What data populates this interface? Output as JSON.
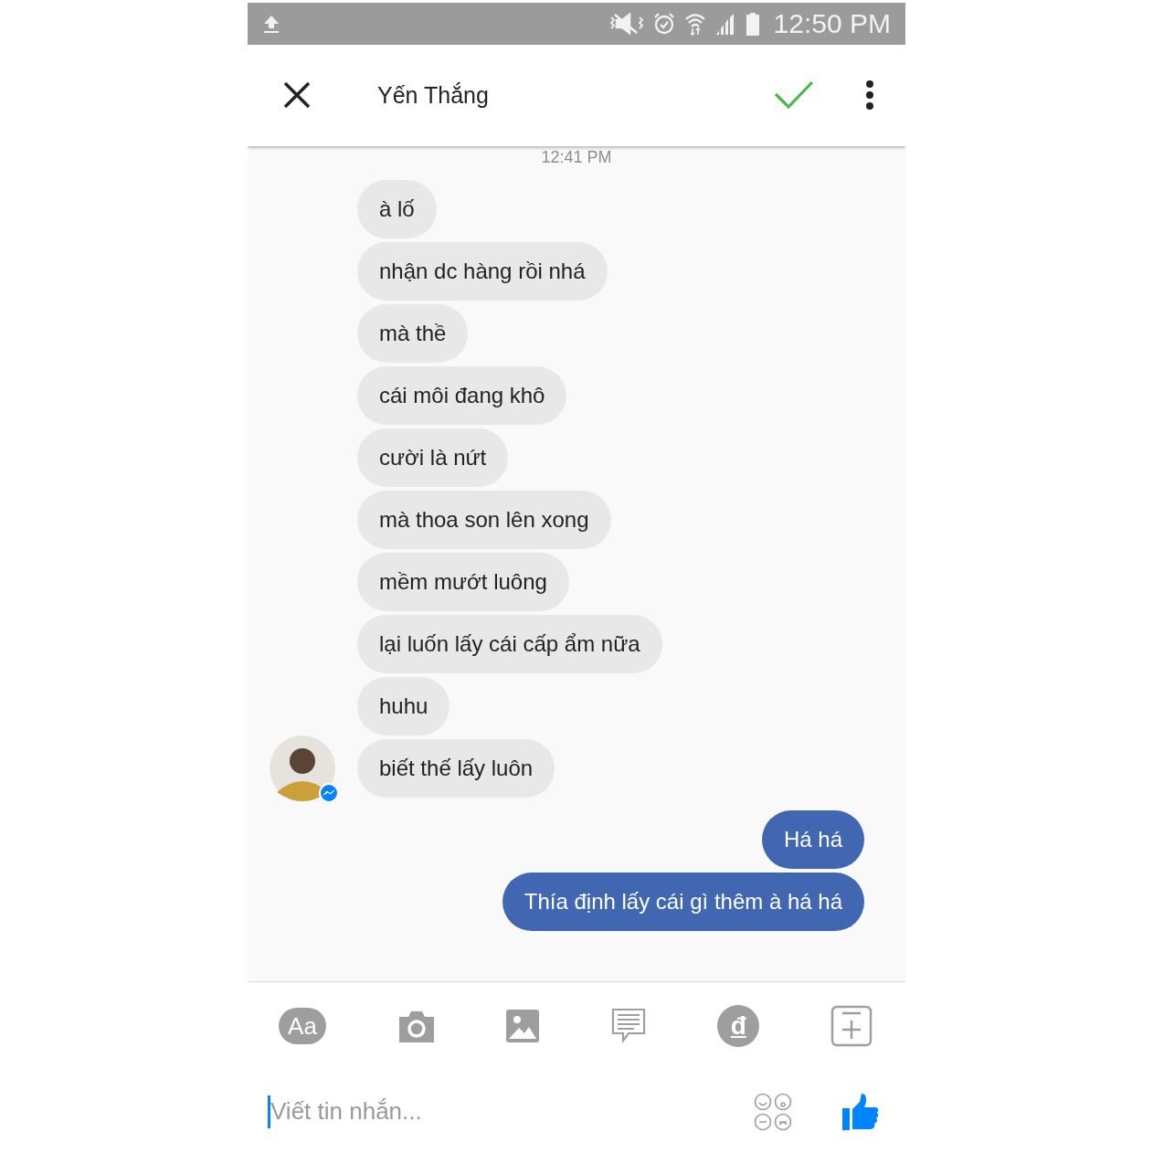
{
  "status_bar": {
    "time": "12:50 PM"
  },
  "header": {
    "title": "Yến Thắng"
  },
  "thread": {
    "timestamp": "12:41 PM",
    "messages": [
      {
        "kind": "incoming",
        "text": "à lố",
        "avatar": false
      },
      {
        "kind": "incoming",
        "text": "nhận dc hàng rồi nhá",
        "avatar": false
      },
      {
        "kind": "incoming",
        "text": "mà thề",
        "avatar": false
      },
      {
        "kind": "incoming",
        "text": "cái môi đang khô",
        "avatar": false
      },
      {
        "kind": "incoming",
        "text": "cười là nứt",
        "avatar": false
      },
      {
        "kind": "incoming",
        "text": "mà thoa son lên xong",
        "avatar": false
      },
      {
        "kind": "incoming",
        "text": "mềm mướt luông",
        "avatar": false
      },
      {
        "kind": "incoming",
        "text": "lại luốn lấy cái cấp ẩm nữa",
        "avatar": false
      },
      {
        "kind": "incoming",
        "text": "huhu",
        "avatar": false
      },
      {
        "kind": "incoming",
        "text": "biết thế lấy luôn",
        "avatar": true
      },
      {
        "kind": "outgoing",
        "text": "Há há",
        "avatar": false
      },
      {
        "kind": "outgoing",
        "text": "Thía định lấy cái gì thêm à há há",
        "avatar": false
      }
    ]
  },
  "toolbar": [
    {
      "kind": "text",
      "label": "Aa"
    },
    {
      "kind": "camera"
    },
    {
      "kind": "gallery"
    },
    {
      "kind": "chat"
    },
    {
      "kind": "payment",
      "label": "đ"
    },
    {
      "kind": "more"
    }
  ],
  "composer": {
    "placeholder": "Viết tin nhắn..."
  }
}
